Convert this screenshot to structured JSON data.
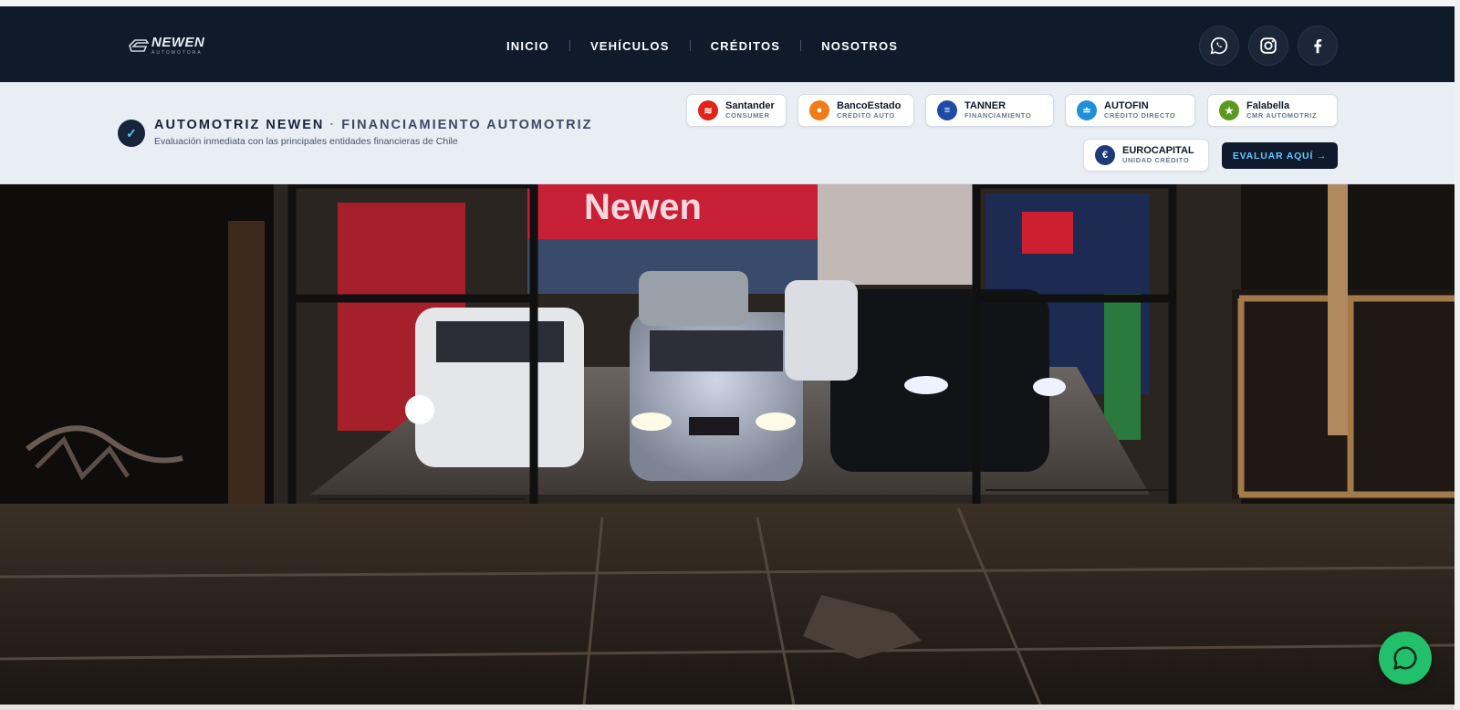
{
  "nav": {
    "logo": {
      "word": "NEWEN",
      "sub": "AUTOMOTORA"
    },
    "items": [
      {
        "label": "INICIO"
      },
      {
        "label": "VEHÍCULOS"
      },
      {
        "label": "CRÉDITOS"
      },
      {
        "label": "NOSOTROS"
      }
    ],
    "social": [
      {
        "icon": "whatsapp-icon"
      },
      {
        "icon": "instagram-icon"
      },
      {
        "icon": "facebook-icon"
      }
    ]
  },
  "banner": {
    "check_icon": "check-icon",
    "title_main": "AUTOMOTRIZ NEWEN",
    "separator": "·",
    "title_accent": "FINANCIAMIENTO AUTOMOTRIZ",
    "subtitle": "Evaluación inmediata con las principales entidades financieras de Chile",
    "lenders": [
      {
        "name": "Santander",
        "sub": "CONSUMER",
        "color": "#e2231a",
        "glyph": "≋"
      },
      {
        "name": "BancoEstado",
        "sub": "CRÉDITO AUTO",
        "color": "#f07c1a",
        "glyph": "●"
      },
      {
        "name": "TANNER",
        "sub": "FINANCIAMIENTO",
        "color": "#1f4aa8",
        "glyph": "≡"
      },
      {
        "name": "AUTOFIN",
        "sub": "CRÉDITO DIRECTO",
        "color": "#1e8fd8",
        "glyph": "≐"
      },
      {
        "name": "Falabella",
        "sub": "CMR AUTOMOTRIZ",
        "color": "#5a9a1e",
        "glyph": "★"
      },
      {
        "name": "EUROCAPITAL",
        "sub": "UNIDAD CRÉDITO",
        "color": "#1d3a78",
        "glyph": "€"
      }
    ],
    "cta_label": "EVALUAR AQUÍ →"
  },
  "hero": {
    "sign_text": "Newen"
  },
  "floating": {
    "icon": "whatsapp-chat-icon"
  },
  "colors": {
    "navbar_bg": "#0f1a2b",
    "banner_bg": "#e9eef4",
    "cta_bg": "#101a2c",
    "cta_text": "#5fc8ff",
    "whatsapp": "#22c06a"
  }
}
